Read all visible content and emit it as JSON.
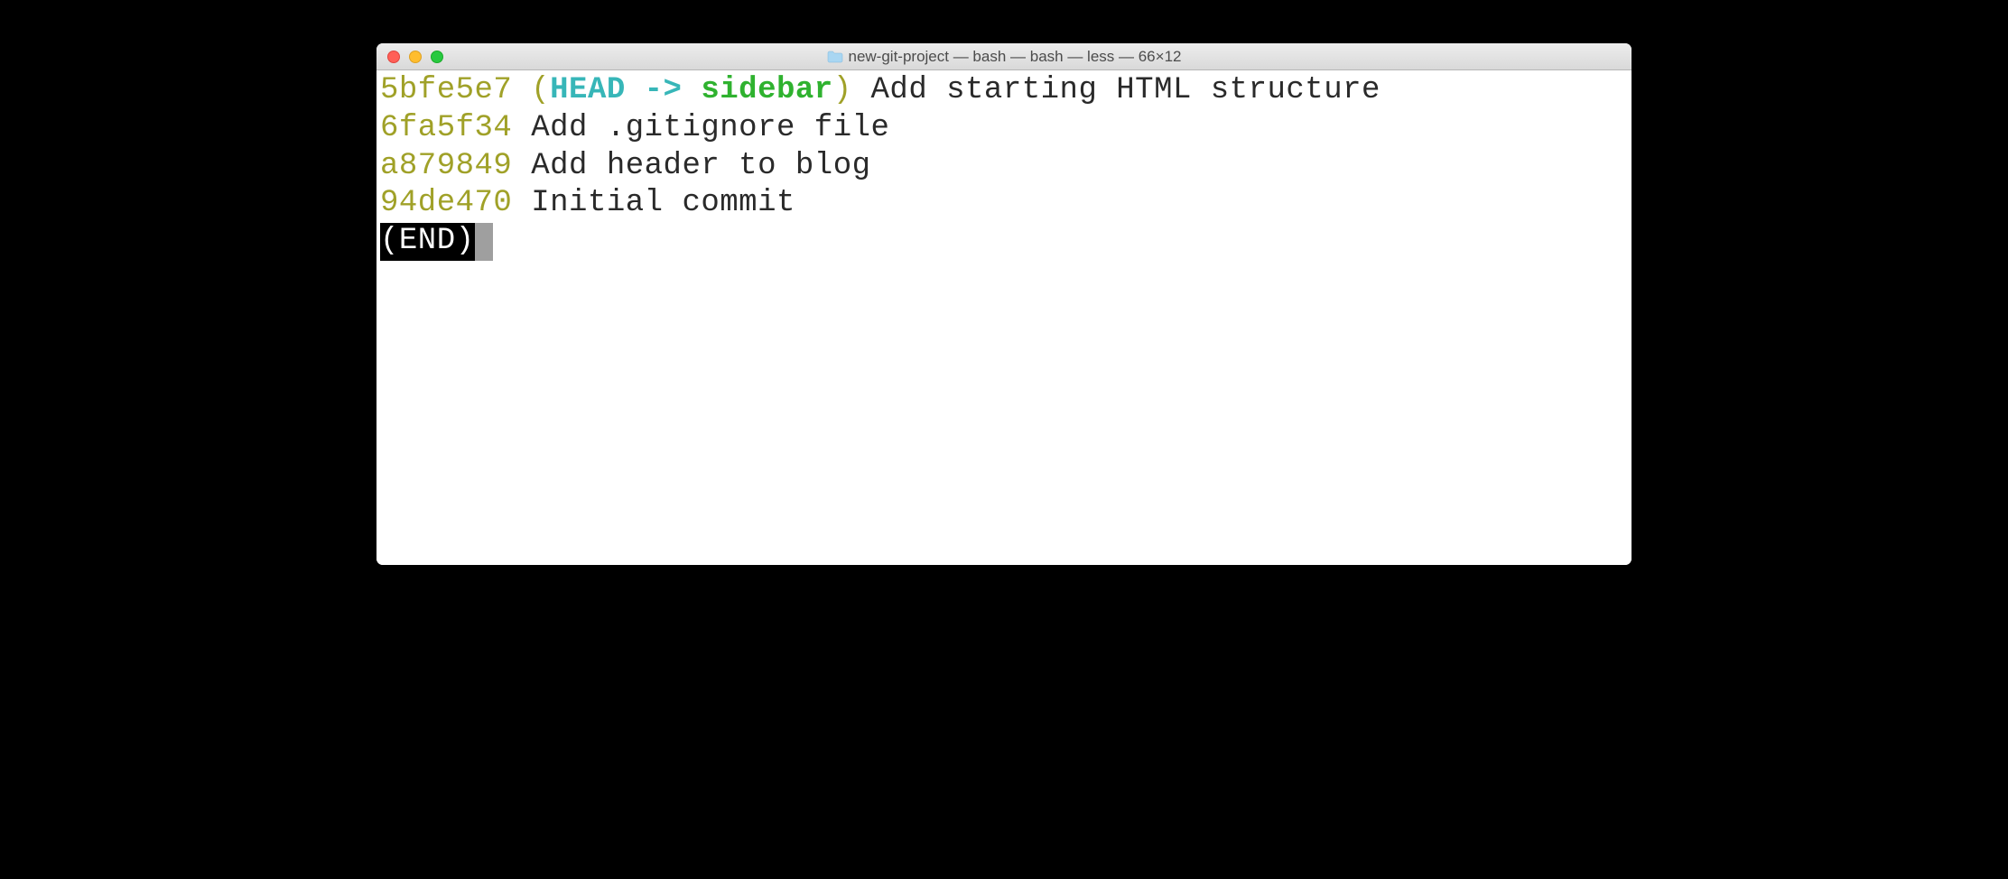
{
  "window": {
    "title": "new-git-project — bash — bash — less — 66×12"
  },
  "log": {
    "commits": [
      {
        "hash": "5bfe5e7",
        "has_ref": true,
        "paren_open": "(",
        "head_label": "HEAD ->",
        "branch": "sidebar",
        "paren_close": ")",
        "message": "Add starting HTML structure"
      },
      {
        "hash": "6fa5f34",
        "has_ref": false,
        "message": "Add .gitignore file"
      },
      {
        "hash": "a879849",
        "has_ref": false,
        "message": "Add header to blog"
      },
      {
        "hash": "94de470",
        "has_ref": false,
        "message": "Initial commit"
      }
    ],
    "end_marker": "(END)"
  }
}
